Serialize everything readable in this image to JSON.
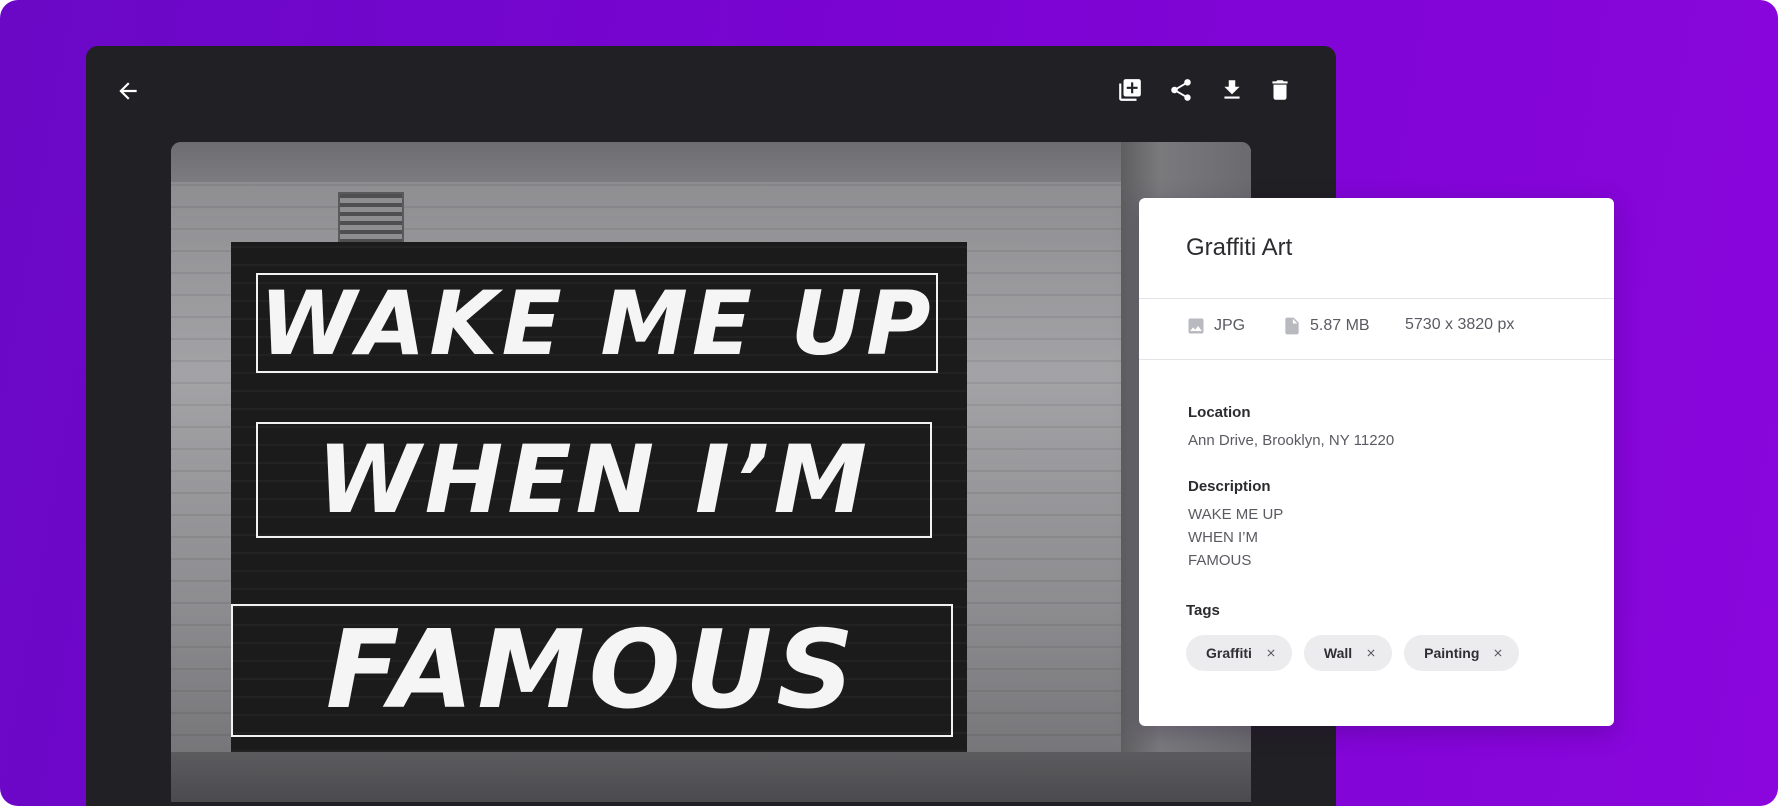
{
  "colors": {
    "background_gradient_start": "#6a08c6",
    "background_gradient_end": "#8a06dc",
    "viewer_bg": "#212024",
    "panel_bg": "#ffffff",
    "tag_bg": "#ececef"
  },
  "viewer": {
    "back_icon": "arrow-left-icon",
    "actions": [
      {
        "name": "add-to-album",
        "icon": "library-add-icon"
      },
      {
        "name": "share",
        "icon": "share-icon"
      },
      {
        "name": "download",
        "icon": "download-icon"
      },
      {
        "name": "delete",
        "icon": "trash-icon"
      }
    ],
    "photo": {
      "lines": [
        "WAKE ME UP",
        "WHEN I’M",
        "FAMOUS"
      ]
    }
  },
  "info": {
    "title": "Graffiti Art",
    "meta": {
      "type": "JPG",
      "size": "5.87 MB",
      "dimensions": "5730 x 3820 px"
    },
    "location": {
      "label": "Location",
      "value": "Ann Drive, Brooklyn, NY 11220"
    },
    "description": {
      "label": "Description",
      "lines": [
        "WAKE ME UP",
        "WHEN I’M",
        "FAMOUS"
      ]
    },
    "tags": {
      "label": "Tags",
      "items": [
        "Graffiti",
        "Wall",
        "Painting"
      ]
    }
  }
}
